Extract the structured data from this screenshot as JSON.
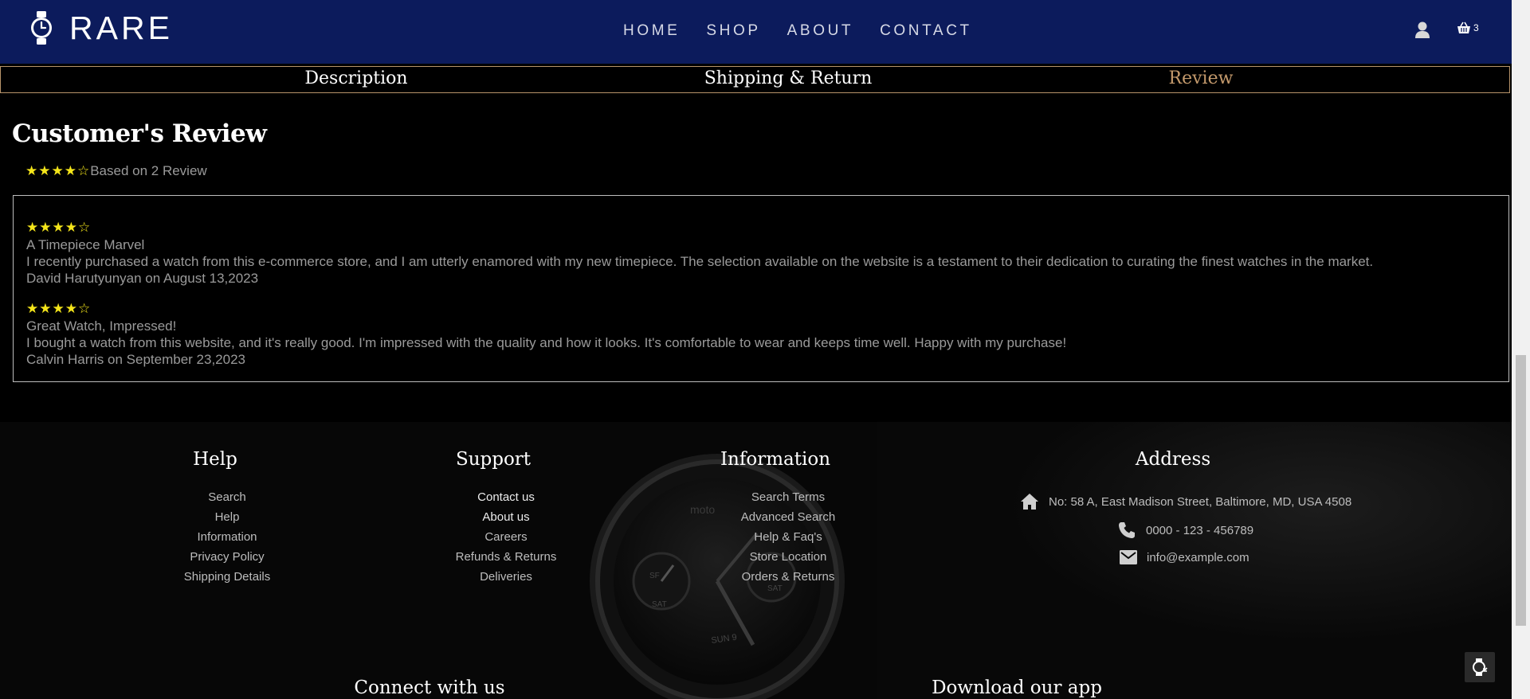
{
  "header": {
    "brand": "RARE",
    "nav": [
      "HOME",
      "SHOP",
      "ABOUT",
      "CONTACT"
    ],
    "cart_count": "3",
    "icons": {
      "logo": "watch-icon",
      "user": "user-icon",
      "cart": "basket-icon"
    }
  },
  "tabs": [
    {
      "label": "Description",
      "active": false
    },
    {
      "label": "Shipping & Return",
      "active": false
    },
    {
      "label": "Review",
      "active": true
    }
  ],
  "reviews_section": {
    "title": "Customer's Review",
    "average_rating": 4,
    "max_rating": 5,
    "summary_text": "Based on 2 Review",
    "reviews": [
      {
        "rating": 4,
        "title": "A Timepiece Marvel",
        "body": "I recently purchased a watch from this e-commerce store, and I am utterly enamored with my new timepiece. The selection available on the website is a testament to their dedication to curating the finest watches in the market.",
        "byline": "David Harutyunyan on August 13,2023"
      },
      {
        "rating": 4,
        "title": "Great Watch, Impressed!",
        "body": "I bought a watch from this website, and it's really good. I'm impressed with the quality and how it looks. It's comfortable to wear and keeps time well. Happy with my purchase!",
        "byline": "Calvin Harris on September 23,2023"
      }
    ]
  },
  "footer": {
    "help": {
      "title": "Help",
      "links": [
        "Search",
        "Help",
        "Information",
        "Privacy Policy",
        "Shipping Details"
      ]
    },
    "support": {
      "title": "Support",
      "links": [
        "Contact us",
        "About us",
        "Careers",
        "Refunds & Returns",
        "Deliveries"
      ]
    },
    "information": {
      "title": "Information",
      "links": [
        "Search Terms",
        "Advanced Search",
        "Help & Faq's",
        "Store Location",
        "Orders & Returns"
      ]
    },
    "address": {
      "title": "Address",
      "street": "No: 58 A, East Madison Street, Baltimore, MD, USA 4508",
      "phone": "0000 - 123 - 456789",
      "email": "info@example.com"
    },
    "connect_title": "Connect with us",
    "app_title": "Download our app"
  },
  "colors": {
    "header_bg": "#0c1b5c",
    "accent": "#c49a6c",
    "star": "#f4e51a",
    "page_bg": "#000000"
  }
}
